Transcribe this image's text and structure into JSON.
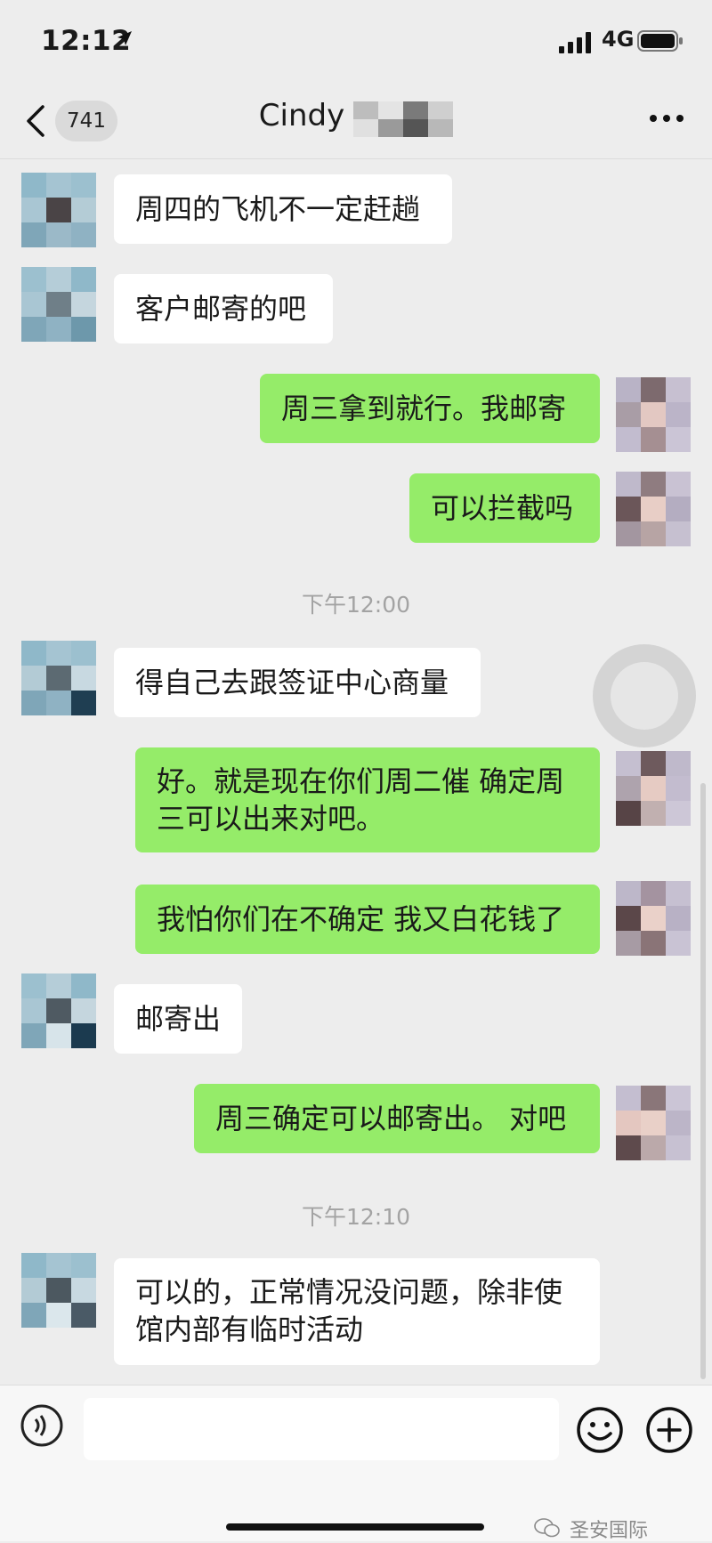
{
  "status_bar": {
    "time": "12:12",
    "network": "4G"
  },
  "nav": {
    "back_count": "741",
    "title": "Cindy"
  },
  "messages": [
    {
      "text": "周四的飞机不一定赶趟"
    },
    {
      "text": "客户邮寄的吧"
    },
    {
      "text": "周三拿到就行。我邮寄"
    },
    {
      "text": "可以拦截吗"
    },
    {
      "text": "下午12:00"
    },
    {
      "text": "得自己去跟签证中心商量"
    },
    {
      "line1": "好。就是现在你们周二催 确定周",
      "line2": "三可以出来对吧。"
    },
    {
      "text": "我怕你们在不确定 我又白花钱了"
    },
    {
      "text": "邮寄出"
    },
    {
      "text": "周三确定可以邮寄出。 对吧"
    },
    {
      "text": "下午12:10"
    },
    {
      "line1": "可以的，正常情况没问题，除非使",
      "line2": "馆内部有临时活动"
    }
  ],
  "watermark": "圣安国际",
  "colors": {
    "outgoing_bubble": "#95ec69",
    "incoming_bubble": "#ffffff",
    "background": "#ededed"
  },
  "icons": [
    "location-arrow-icon",
    "signal-icon",
    "battery-icon",
    "back-chevron-icon",
    "more-icon",
    "voice-icon",
    "emoji-icon",
    "plus-icon",
    "wechat-icon"
  ]
}
